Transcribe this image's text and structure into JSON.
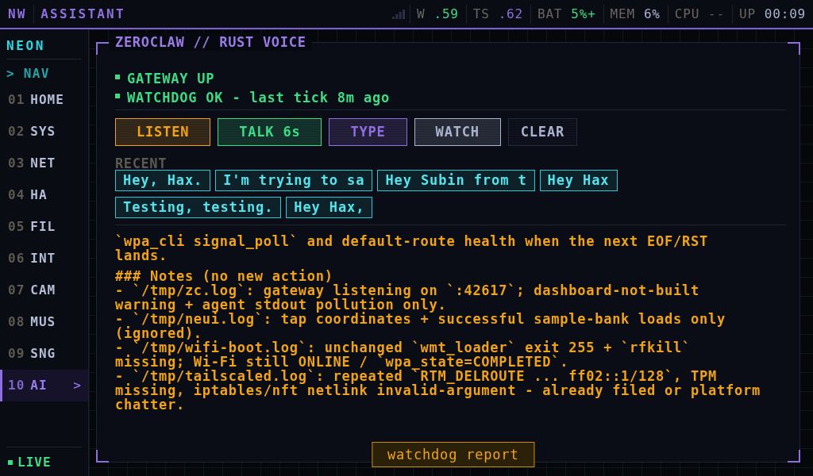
{
  "top_bar": {
    "logo": "NW",
    "title": "ASSISTANT",
    "stats": [
      {
        "label": "W",
        "value": ".59",
        "color": "#3ddc84"
      },
      {
        "label": "TS",
        "value": ".62",
        "color": "#8f6ee0"
      },
      {
        "label": "BAT",
        "value": "5%+",
        "color": "#3ddc84"
      },
      {
        "label": "MEM",
        "value": "6%",
        "color": "#aab4cf"
      },
      {
        "label": "CPU",
        "value": "--",
        "color": "#5d5850"
      },
      {
        "label": "UP",
        "value": "00:09",
        "color": "#aab4cf"
      }
    ]
  },
  "sidebar": {
    "brand": "NEON",
    "section": "> NAV",
    "items": [
      {
        "number": "01",
        "label": "HOME",
        "selected": false
      },
      {
        "number": "02",
        "label": "SYS",
        "selected": false
      },
      {
        "number": "03",
        "label": "NET",
        "selected": false
      },
      {
        "number": "04",
        "label": "HA",
        "selected": false
      },
      {
        "number": "05",
        "label": "FIL",
        "selected": false
      },
      {
        "number": "06",
        "label": "INT",
        "selected": false
      },
      {
        "number": "07",
        "label": "CAM",
        "selected": false
      },
      {
        "number": "08",
        "label": "MUS",
        "selected": false
      },
      {
        "number": "09",
        "label": "SNG",
        "selected": false
      },
      {
        "number": "10",
        "label": "AI",
        "selected": true,
        "indicator": ">"
      }
    ],
    "footer": {
      "label": "LIVE"
    }
  },
  "panel": {
    "title": "ZEROCLAW // RUST VOICE",
    "status": [
      {
        "text": "GATEWAY UP"
      },
      {
        "text": "WATCHDOG OK - last tick 8m ago"
      }
    ],
    "buttons": [
      {
        "label": "LISTEN",
        "kind": "mode",
        "color": "#f0a31a"
      },
      {
        "label": "TALK 6s",
        "kind": "mode",
        "color": "#3ddc84"
      },
      {
        "label": "TYPE",
        "kind": "mode",
        "color": "#8f6ee0"
      },
      {
        "label": "WATCH",
        "kind": "mode",
        "color": "#aab4cf"
      },
      {
        "label": "CLEAR",
        "kind": "action"
      }
    ],
    "recent": {
      "label": "RECENT",
      "items": [
        "Hey, Hax.",
        "I'm trying to sa",
        "Hey Subin from t",
        "Hey Hax",
        "Testing, testing.",
        "Hey Hax,"
      ]
    },
    "log": {
      "summary": [
        "`wpa_cli signal_poll` and default-route health when the next EOF/RST",
        "lands."
      ],
      "notes": {
        "heading": "### Notes (no new action)",
        "items": [
          [
            "- `/tmp/zc.log`: gateway listening on `:42617`; dashboard-not-built",
            "warning + agent stdout pollution only."
          ],
          [
            "- `/tmp/neui.log`: tap coordinates + successful sample-bank loads only",
            "(ignored)."
          ],
          [
            "- `/tmp/wifi-boot.log`: unchanged `wmt_loader` exit 255 + `rfkill`",
            "missing; Wi-Fi still ONLINE / `wpa_state=COMPLETED`."
          ],
          [
            "- `/tmp/tailscaled.log`: repeated `RTM_DELROUTE ... ff02::1/128`, TPM",
            "missing, iptables/nft netlink invalid-argument - already filed or platform",
            "chatter."
          ]
        ]
      }
    },
    "footer_button": "watchdog report"
  }
}
